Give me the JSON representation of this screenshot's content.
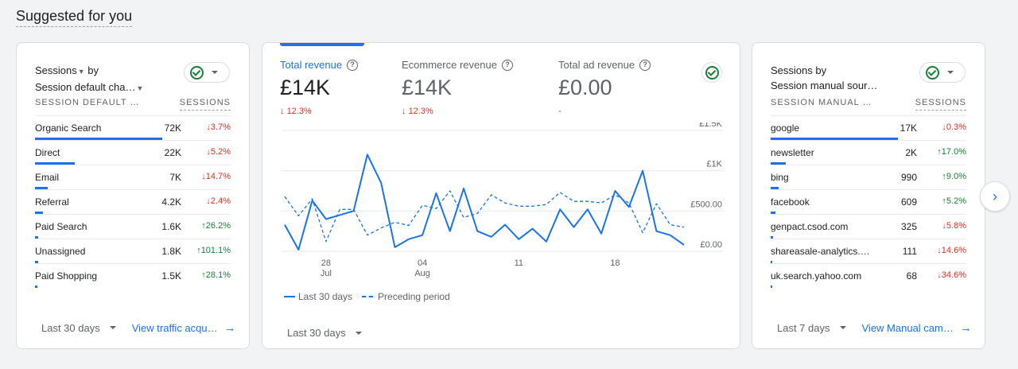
{
  "section_title": "Suggested for you",
  "left_card": {
    "title_line1": "Sessions",
    "title_by": " by",
    "title_line2": "Session default cha…",
    "col_dim": "SESSION DEFAULT …",
    "col_metric": "SESSIONS",
    "rows": [
      {
        "name": "Organic Search",
        "value": "72K",
        "change": "3.7%",
        "dir": "down",
        "share": 1.0
      },
      {
        "name": "Direct",
        "value": "22K",
        "change": "5.2%",
        "dir": "down",
        "share": 0.31
      },
      {
        "name": "Email",
        "value": "7K",
        "change": "14.7%",
        "dir": "down",
        "share": 0.1
      },
      {
        "name": "Referral",
        "value": "4.2K",
        "change": "2.4%",
        "dir": "down",
        "share": 0.06
      },
      {
        "name": "Paid Search",
        "value": "1.6K",
        "change": "26.2%",
        "dir": "up",
        "share": 0.022
      },
      {
        "name": "Unassigned",
        "value": "1.8K",
        "change": "101.1%",
        "dir": "up",
        "share": 0.025
      },
      {
        "name": "Paid Shopping",
        "value": "1.5K",
        "change": "28.1%",
        "dir": "up",
        "share": 0.021
      }
    ],
    "period": "Last 30 days",
    "link": "View traffic acqu…"
  },
  "mid_card": {
    "metrics": [
      {
        "label": "Total revenue",
        "value": "£14K",
        "change": "12.3%",
        "dir": "down"
      },
      {
        "label": "Ecommerce revenue",
        "value": "£14K",
        "change": "12.3%",
        "dir": "down"
      },
      {
        "label": "Total ad revenue",
        "value": "£0.00",
        "change": "-",
        "dir": "none"
      }
    ],
    "legend_current": "Last 30 days",
    "legend_previous": "Preceding period",
    "period": "Last 30 days"
  },
  "right_card": {
    "title_line1": "Sessions by",
    "title_line2": "Session manual sour…",
    "col_dim": "SESSION MANUAL …",
    "col_metric": "SESSIONS",
    "rows": [
      {
        "name": "google",
        "value": "17K",
        "change": "0.3%",
        "dir": "down",
        "share": 1.0
      },
      {
        "name": "newsletter",
        "value": "2K",
        "change": "17.0%",
        "dir": "up",
        "share": 0.12
      },
      {
        "name": "bing",
        "value": "990",
        "change": "9.0%",
        "dir": "up",
        "share": 0.06
      },
      {
        "name": "facebook",
        "value": "609",
        "change": "5.2%",
        "dir": "up",
        "share": 0.036
      },
      {
        "name": "genpact.csod.com",
        "value": "325",
        "change": "5.8%",
        "dir": "down",
        "share": 0.019
      },
      {
        "name": "shareasale-analytics.…",
        "value": "111",
        "change": "14.6%",
        "dir": "down",
        "share": 0.007
      },
      {
        "name": "uk.search.yahoo.com",
        "value": "68",
        "change": "34.6%",
        "dir": "down",
        "share": 0.004
      }
    ],
    "period": "Last 7 days",
    "link": "View Manual cam…"
  },
  "chart_data": {
    "type": "line",
    "x_ticks": [
      {
        "day": "28",
        "month": "Jul",
        "index": 3
      },
      {
        "day": "04",
        "month": "Aug",
        "index": 10
      },
      {
        "day": "11",
        "month": "",
        "index": 17
      },
      {
        "day": "18",
        "month": "",
        "index": 24
      }
    ],
    "y_ticks": [
      "£0.00",
      "£500.00",
      "£1K",
      "£1.5K"
    ],
    "ylim": [
      0,
      1500
    ],
    "series": [
      {
        "name": "Last 30 days",
        "style": "solid",
        "color": "#1a73e8",
        "values": [
          330,
          20,
          630,
          400,
          450,
          500,
          1200,
          850,
          50,
          150,
          200,
          720,
          250,
          780,
          250,
          180,
          330,
          150,
          280,
          120,
          520,
          300,
          520,
          220,
          750,
          550,
          1000,
          250,
          200,
          80
        ]
      },
      {
        "name": "Preceding period",
        "style": "dashed",
        "color": "#1a73e8",
        "values": [
          680,
          440,
          650,
          120,
          520,
          520,
          200,
          290,
          360,
          320,
          570,
          530,
          750,
          420,
          470,
          700,
          600,
          560,
          560,
          580,
          730,
          620,
          620,
          600,
          700,
          600,
          230,
          590,
          330,
          300
        ]
      }
    ]
  }
}
